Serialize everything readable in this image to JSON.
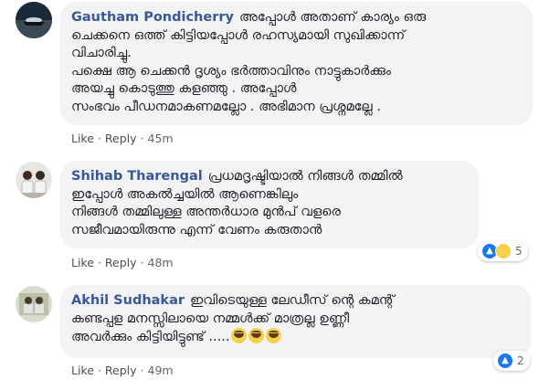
{
  "comments": [
    {
      "author": "Gautham Pondicherry",
      "lines": [
        "അപ്പോൾ അതാണ് കാര്യം ഒരു",
        "ചെക്കനെ ഒത്ത് കിട്ടിയപ്പോൾ രഹസ്യമായി സുഖിക്കാന്ന്",
        "വിചാരിച്ചു.",
        "പക്ഷെ ആ ചെക്കൻ ദൃശ്യം ഭർത്താവിനും നാട്ടുകാർക്കും",
        "അയച്ചു കൊടുത്തു കളഞ്ഞു . അപ്പോൾ",
        "സംഭവം പീഡനമാകണമല്ലോ . അഭിമാന പ്രശ്നമല്ലേ ."
      ],
      "like_label": "Like",
      "reply_label": "Reply",
      "time": "45m"
    },
    {
      "author": "Shihab Tharengal",
      "lines": [
        "പ്രധമദൃഷ്ടിയാൽ നിങ്ങൾ തമ്മിൽ",
        "ഇപ്പോൾ അകൽച്ചയിൽ ആണെങ്കിലും",
        "നിങ്ങൾ തമ്മിലുള്ള അന്തർധാര മുൻപ് വളരെ",
        "സജീവമായിരുന്നു എന്ന് വേണം കരുതാൻ"
      ],
      "like_label": "Like",
      "reply_label": "Reply",
      "time": "48m",
      "reaction_count": "5"
    },
    {
      "author": "Akhil Sudhakar",
      "lines": [
        "ഇവിടെയുള്ള ലേഡീസ് ന്റെ കമന്റ്",
        "കണ്ടപ്പള മനസ്സിലായെ നമ്മൾക്ക് മാത്രല്ല ഉണ്ണീ",
        "അവർക്കും കിട്ടിയിട്ടുണ്ട് ....."
      ],
      "like_label": "Like",
      "reply_label": "Reply",
      "time": "49m",
      "reaction_count": "2"
    }
  ],
  "separator": "·",
  "colors": {
    "author": "#385898",
    "bubble": "#f2f3f5",
    "meta": "#606770"
  },
  "icons": {
    "like": "like-reaction-icon",
    "haha": "haha-reaction-icon"
  }
}
